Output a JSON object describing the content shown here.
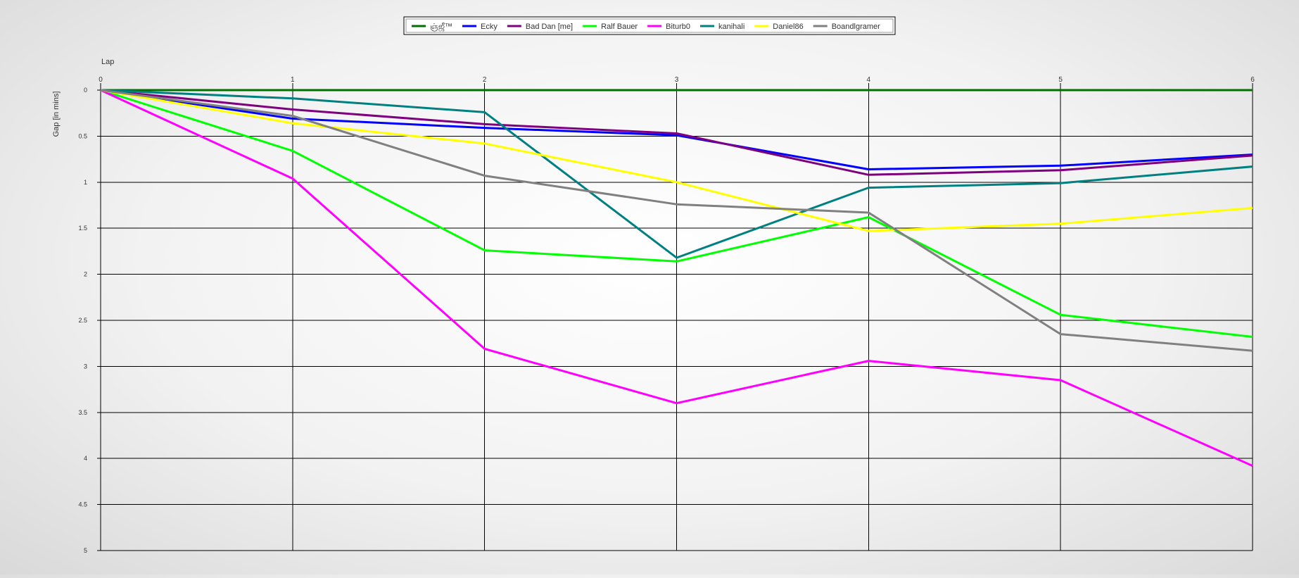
{
  "chart_data": {
    "type": "line",
    "xlabel": "Lap",
    "ylabel": "Gap [in mins]",
    "x": [
      0,
      1,
      2,
      3,
      4,
      5,
      6
    ],
    "xlim": [
      0,
      6
    ],
    "ylim": [
      0,
      5
    ],
    "y_inverted": true,
    "y_ticks": [
      "0",
      "0.5",
      "1",
      "1.5",
      "2",
      "2.5",
      "3",
      "3.5",
      "4",
      "4.5",
      "5"
    ],
    "x_ticks": [
      "0",
      "1",
      "2",
      "3",
      "4",
      "5",
      "6"
    ],
    "grid": true,
    "legend_position": "top-center",
    "series": [
      {
        "name": "ஞ்ஜீ™",
        "color": "#007000",
        "values": [
          0,
          0,
          0,
          0,
          0,
          0,
          0
        ]
      },
      {
        "name": "Ecky",
        "color": "#0000ff",
        "values": [
          0,
          0.31,
          0.41,
          0.49,
          0.86,
          0.82,
          0.7
        ]
      },
      {
        "name": "Bad Dan [me]",
        "color": "#7f007f",
        "values": [
          0,
          0.21,
          0.37,
          0.47,
          0.92,
          0.87,
          0.71
        ]
      },
      {
        "name": "Ralf Bauer",
        "color": "#00ff00",
        "values": [
          0,
          0.66,
          1.74,
          1.86,
          1.38,
          2.44,
          2.68
        ]
      },
      {
        "name": "Biturb0",
        "color": "#ff00ff",
        "values": [
          0,
          0.96,
          2.81,
          3.4,
          2.94,
          3.15,
          4.08
        ]
      },
      {
        "name": "kanihali",
        "color": "#008080",
        "values": [
          0,
          0.09,
          0.24,
          1.82,
          1.06,
          1.01,
          0.83
        ]
      },
      {
        "name": "Daniel86",
        "color": "#ffff00",
        "values": [
          0,
          0.36,
          0.58,
          1.0,
          1.53,
          1.45,
          1.28
        ]
      },
      {
        "name": "Boandlgramer",
        "color": "#808080",
        "values": [
          0,
          0.28,
          0.93,
          1.24,
          1.33,
          2.65,
          2.83
        ]
      }
    ]
  }
}
